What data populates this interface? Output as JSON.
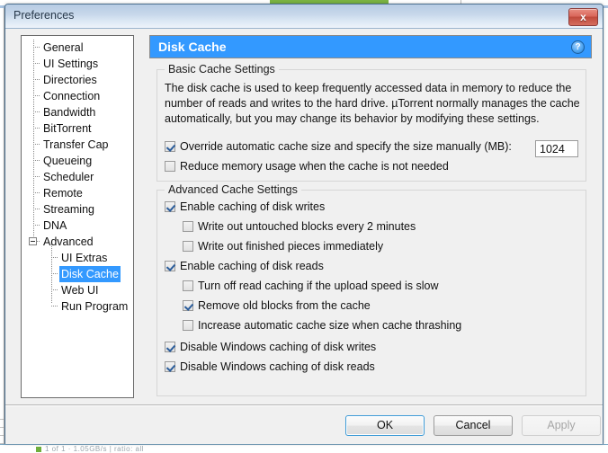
{
  "window": {
    "title": "Preferences",
    "close_label": "x"
  },
  "background": {
    "status_line": "1 of 1 · 1.05GB/s  |  ratio: all"
  },
  "sidebar": {
    "items": [
      {
        "label": "General",
        "level": 1,
        "selected": false,
        "expander": false
      },
      {
        "label": "UI Settings",
        "level": 1,
        "selected": false,
        "expander": false
      },
      {
        "label": "Directories",
        "level": 1,
        "selected": false,
        "expander": false
      },
      {
        "label": "Connection",
        "level": 1,
        "selected": false,
        "expander": false
      },
      {
        "label": "Bandwidth",
        "level": 1,
        "selected": false,
        "expander": false
      },
      {
        "label": "BitTorrent",
        "level": 1,
        "selected": false,
        "expander": false
      },
      {
        "label": "Transfer Cap",
        "level": 1,
        "selected": false,
        "expander": false
      },
      {
        "label": "Queueing",
        "level": 1,
        "selected": false,
        "expander": false
      },
      {
        "label": "Scheduler",
        "level": 1,
        "selected": false,
        "expander": false
      },
      {
        "label": "Remote",
        "level": 1,
        "selected": false,
        "expander": false
      },
      {
        "label": "Streaming",
        "level": 1,
        "selected": false,
        "expander": false
      },
      {
        "label": "DNA",
        "level": 1,
        "selected": false,
        "expander": false
      },
      {
        "label": "Advanced",
        "level": 1,
        "selected": false,
        "expander": true
      },
      {
        "label": "UI Extras",
        "level": 2,
        "selected": false,
        "expander": false
      },
      {
        "label": "Disk Cache",
        "level": 2,
        "selected": true,
        "expander": false
      },
      {
        "label": "Web UI",
        "level": 2,
        "selected": false,
        "expander": false
      },
      {
        "label": "Run Program",
        "level": 2,
        "selected": false,
        "expander": false
      }
    ]
  },
  "header": {
    "title": "Disk Cache",
    "help_glyph": "?",
    "accent_color": "#3399ff"
  },
  "basic_group": {
    "title": "Basic Cache Settings",
    "description": "The disk cache is used to keep frequently accessed data in memory to reduce the number of reads and writes to the hard drive. µTorrent normally manages the cache automatically, but you may change its behavior by modifying these settings.",
    "options": [
      {
        "label": "Override automatic cache size and specify the size manually (MB):",
        "checked": true
      },
      {
        "label": "Reduce memory usage when the cache is not needed",
        "checked": false
      }
    ],
    "cache_size_value": "1024"
  },
  "advanced_group": {
    "title": "Advanced Cache Settings",
    "options": [
      {
        "label": "Enable caching of disk writes",
        "checked": true,
        "indent": false
      },
      {
        "label": "Write out untouched blocks every 2 minutes",
        "checked": false,
        "indent": true
      },
      {
        "label": "Write out finished pieces immediately",
        "checked": false,
        "indent": true
      },
      {
        "label": "Enable caching of disk reads",
        "checked": true,
        "indent": false
      },
      {
        "label": "Turn off read caching if the upload speed is slow",
        "checked": false,
        "indent": true
      },
      {
        "label": "Remove old blocks from the cache",
        "checked": true,
        "indent": true
      },
      {
        "label": "Increase automatic cache size when cache thrashing",
        "checked": false,
        "indent": true
      },
      {
        "label": "Disable Windows caching of disk writes",
        "checked": true,
        "indent": false
      },
      {
        "label": "Disable Windows caching of disk reads",
        "checked": true,
        "indent": false
      }
    ]
  },
  "footer": {
    "ok_label": "OK",
    "cancel_label": "Cancel",
    "apply_label": "Apply"
  }
}
